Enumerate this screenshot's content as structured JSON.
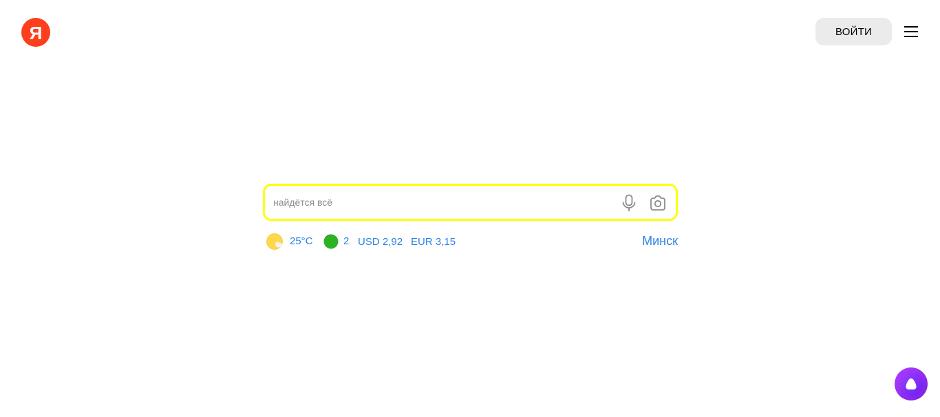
{
  "header": {
    "logo_letter": "Я",
    "login_label": "ВОЙТИ",
    "menu_icon": "hamburger-icon"
  },
  "search": {
    "placeholder": "найдётся всё",
    "value": "",
    "mic_icon": "microphone-icon",
    "camera_icon": "camera-icon"
  },
  "informers": {
    "weather": {
      "icon": "weather-sun-cloud-icon",
      "temperature": "25°C"
    },
    "traffic": {
      "icon": "traffic-icon",
      "level": "2"
    },
    "rates": {
      "usd": "USD 2,92",
      "eur": "EUR 3,15"
    },
    "city": "Минск"
  },
  "alice": {
    "icon": "alice-icon"
  },
  "colors": {
    "brand_red": "#fc3f1d",
    "search_border": "#ffff00",
    "link_blue": "#2a82e4",
    "alice_purple": "#8a2be2",
    "traffic_green": "#2db224"
  }
}
